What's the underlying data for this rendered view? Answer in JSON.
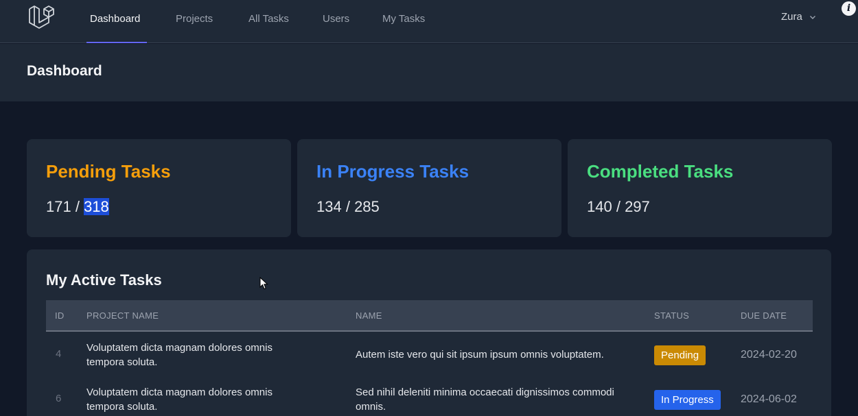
{
  "nav": {
    "links": [
      {
        "label": "Dashboard",
        "active": true
      },
      {
        "label": "Projects",
        "active": false
      },
      {
        "label": "All Tasks",
        "active": false
      },
      {
        "label": "Users",
        "active": false
      },
      {
        "label": "My Tasks",
        "active": false
      }
    ],
    "user": "Zura"
  },
  "header": {
    "title": "Dashboard"
  },
  "stats": [
    {
      "title": "Pending Tasks",
      "mine": "171",
      "sep": " / ",
      "total": "318",
      "color": "#f59e0b"
    },
    {
      "title": "In Progress Tasks",
      "mine": "134",
      "sep": " / ",
      "total": "285",
      "color": "#3b82f6"
    },
    {
      "title": "Completed Tasks",
      "mine": "140",
      "sep": " / ",
      "total": "297",
      "color": "#22c55e"
    }
  ],
  "tasks": {
    "title": "My Active Tasks",
    "columns": [
      "ID",
      "PROJECT NAME",
      "NAME",
      "STATUS",
      "DUE DATE"
    ],
    "rows": [
      {
        "id": "4",
        "project": "Voluptatem dicta magnam dolores omnis tempora soluta.",
        "name": "Autem iste vero qui sit ipsum ipsum omnis voluptatem.",
        "status": "Pending",
        "status_color": "#ca8a04",
        "due": "2024-02-20"
      },
      {
        "id": "6",
        "project": "Voluptatem dicta magnam dolores omnis tempora soluta.",
        "name": "Sed nihil deleniti minima occaecati dignissimos commodi omnis.",
        "status": "In Progress",
        "status_color": "#2563eb",
        "due": "2024-06-02"
      }
    ]
  }
}
